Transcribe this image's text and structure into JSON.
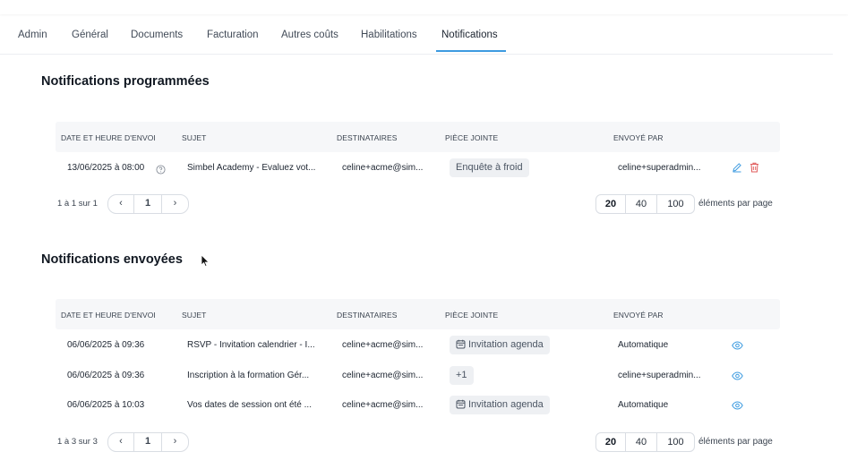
{
  "tabs": [
    "Admin",
    "Général",
    "Documents",
    "Facturation",
    "Autres coûts",
    "Habilitations",
    "Notifications"
  ],
  "colors": {
    "accent": "#3d9be0",
    "danger": "#e05a5a",
    "header_bg": "#f6f7f9",
    "chip_bg": "#eef0f3"
  },
  "scheduled": {
    "title": "Notifications programmées",
    "columns": [
      "DATE ET HEURE D'ENVOI",
      "SUJET",
      "DESTINATAIRES",
      "PIÈCE JOINTE",
      "ENVOYÉ PAR"
    ],
    "rows": [
      {
        "date": "13/06/2025 à 08:00",
        "subject": "Simbel Academy - Evaluez vot...",
        "recipients": "celine+acme@sim...",
        "attachment": "Enquête à froid",
        "sent_by": "celine+superadmin...",
        "icons": [
          "info-circle-icon",
          "edit-pencil-icon",
          "trash-icon"
        ]
      }
    ],
    "pagination": {
      "info": "1 à 1 sur 1",
      "prev": "‹",
      "page": "1",
      "next": "›"
    },
    "page_sizes": [
      "20",
      "40",
      "100"
    ],
    "page_size_selected": "20",
    "per_page_label": "éléments par page"
  },
  "sent": {
    "title": "Notifications envoyées",
    "columns": [
      "DATE ET HEURE D'ENVOI",
      "SUJET",
      "DESTINATAIRES",
      "PIÈCE JOINTE",
      "ENVOYÉ PAR"
    ],
    "rows": [
      {
        "date": "06/06/2025 à 09:36",
        "subject": "RSVP - Invitation calendrier - I...",
        "recipients": "celine+acme@sim...",
        "attachment": "Invitation agenda",
        "attachment_icon": "calendar-icon",
        "sent_by": "Automatique",
        "icon": "eye-icon"
      },
      {
        "date": "06/06/2025 à 09:36",
        "subject": "Inscription à la formation Gér...",
        "recipients": "celine+acme@sim...",
        "attachment": "+1",
        "attachment_icon": "",
        "sent_by": "celine+superadmin...",
        "icon": "eye-icon"
      },
      {
        "date": "06/06/2025 à 10:03",
        "subject": "Vos dates de session ont été ...",
        "recipients": "celine+acme@sim...",
        "attachment": "Invitation agenda",
        "attachment_icon": "calendar-icon",
        "sent_by": "Automatique",
        "icon": "eye-icon"
      }
    ],
    "pagination": {
      "info": "1 à 3 sur 3",
      "prev": "‹",
      "page": "1",
      "next": "›"
    },
    "page_sizes": [
      "20",
      "40",
      "100"
    ],
    "page_size_selected": "20",
    "per_page_label": "éléments par page"
  }
}
